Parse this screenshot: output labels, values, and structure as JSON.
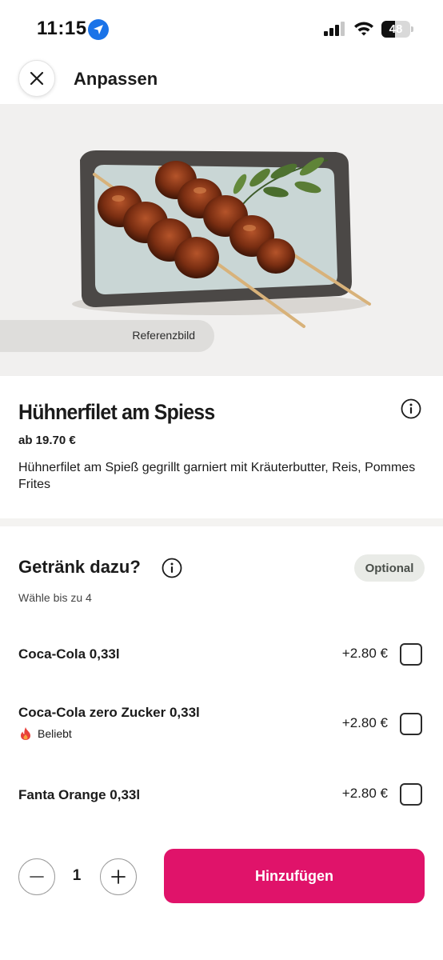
{
  "status_bar": {
    "time": "11:15",
    "battery": "48",
    "battery_level": 0.48,
    "icons": [
      "location-arrow-icon",
      "cellular-signal-icon",
      "wifi-icon",
      "battery-icon"
    ]
  },
  "header": {
    "title": "Anpassen",
    "close_icon": "close-icon"
  },
  "hero": {
    "badge": "Referenzbild"
  },
  "product": {
    "name": "Hühnerfilet am Spiess",
    "price": "ab 19.70 €",
    "description": "Hühnerfilet am Spieß gegrillt garniert mit Kräuterbutter, Reis, Pommes Frites",
    "info_icon": "info-icon"
  },
  "options": {
    "title": "Getränk dazu?",
    "badge": "Optional",
    "subtitle": "Wähle bis zu 4",
    "items": [
      {
        "name": "Coca-Cola 0,33l",
        "price": "+2.80 €",
        "checked": false
      },
      {
        "name": "Coca-Cola zero Zucker 0,33l",
        "price": "+2.80 €",
        "checked": false,
        "tag": "Beliebt",
        "tag_icon": "flame-icon"
      },
      {
        "name": "Fanta Orange 0,33l",
        "price": "+2.80 €",
        "checked": false
      }
    ]
  },
  "footer": {
    "quantity": "1",
    "add_label": "Hinzufügen",
    "accent_color": "#e0136a"
  }
}
